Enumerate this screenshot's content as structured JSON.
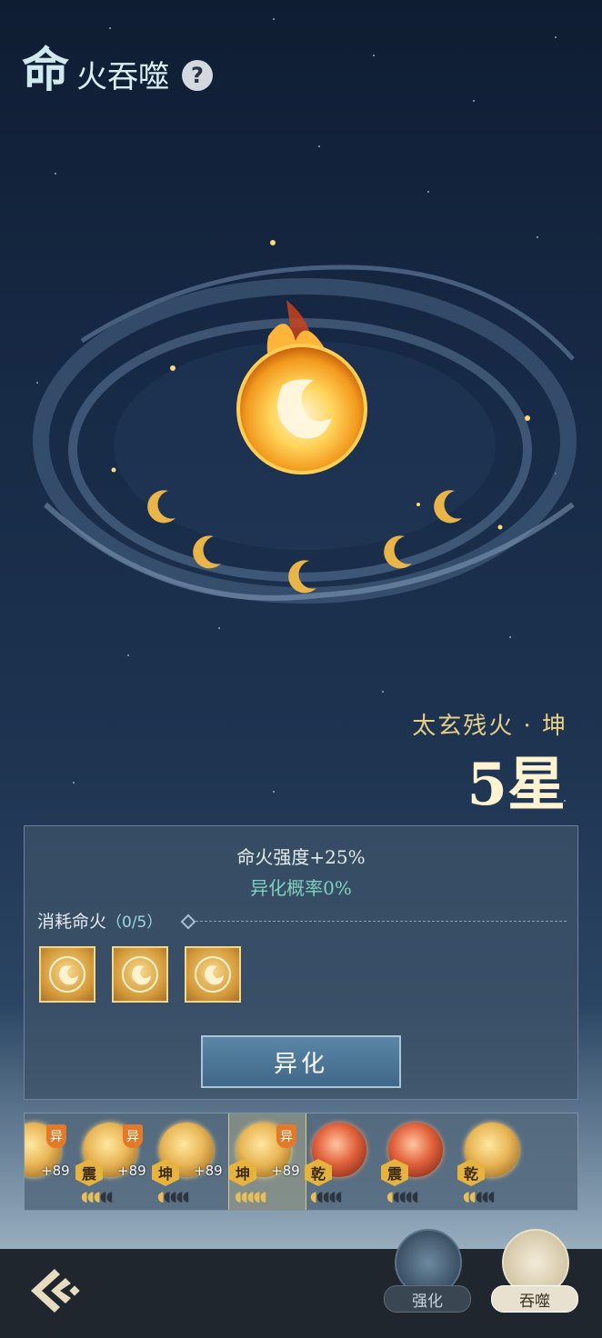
{
  "header": {
    "title_big": "命",
    "title_rest": "火吞噬",
    "help_label": "?"
  },
  "fire": {
    "name": "太玄残火 · 坤",
    "level": "5星"
  },
  "panel": {
    "stat_strength": "命火强度+25%",
    "stat_mutation": "异化概率0%",
    "consume_label": "消耗命火",
    "consume_count": "（0/5）",
    "action_label": "异化"
  },
  "inventory": [
    {
      "element": "",
      "plus": "+89",
      "mutated": true,
      "orb": "gold",
      "pips_on": 0,
      "pips_total": 2
    },
    {
      "element": "震",
      "plus": "+89",
      "mutated": true,
      "orb": "gold",
      "pips_on": 3,
      "pips_total": 5
    },
    {
      "element": "坤",
      "plus": "+89",
      "mutated": false,
      "orb": "gold",
      "pips_on": 1,
      "pips_total": 5
    },
    {
      "element": "坤",
      "plus": "+89",
      "mutated": true,
      "orb": "gold",
      "pips_on": 5,
      "pips_total": 5,
      "selected": true
    },
    {
      "element": "乾",
      "plus": "",
      "mutated": false,
      "orb": "red",
      "pips_on": 1,
      "pips_total": 5
    },
    {
      "element": "震",
      "plus": "",
      "mutated": false,
      "orb": "red",
      "pips_on": 1,
      "pips_total": 5
    },
    {
      "element": "乾",
      "plus": "",
      "mutated": false,
      "orb": "gold",
      "pips_on": 2,
      "pips_total": 5
    }
  ],
  "badges": {
    "mutation_badge": "异"
  },
  "nav": {
    "tab_strengthen": "强化",
    "tab_devour": "吞噬"
  },
  "colors": {
    "accent_gold": "#e6cf86",
    "mutation_green": "#7fd1bf",
    "button_blue": "#4f7798"
  }
}
